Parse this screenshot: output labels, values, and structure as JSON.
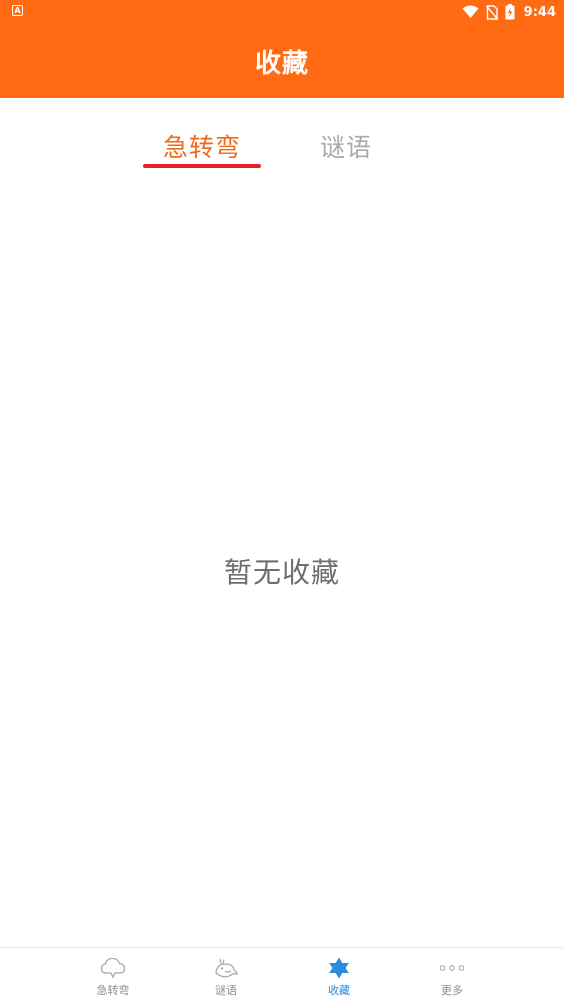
{
  "status_bar": {
    "left_icon": "a-notification-icon",
    "time": "9:44",
    "icons": [
      "wifi-icon",
      "no-sim-icon",
      "battery-charging-icon"
    ]
  },
  "header": {
    "title": "收藏"
  },
  "tabs": [
    {
      "label": "急转弯",
      "active": true
    },
    {
      "label": "谜语",
      "active": false
    }
  ],
  "content": {
    "empty_message": "暂无收藏"
  },
  "bottom_nav": {
    "items": [
      {
        "label": "急转弯",
        "icon": "cloud-icon",
        "active": false
      },
      {
        "label": "谜语",
        "icon": "bird-icon",
        "active": false
      },
      {
        "label": "收藏",
        "icon": "star-icon",
        "active": true
      },
      {
        "label": "更多",
        "icon": "more-dots-icon",
        "active": false
      }
    ]
  },
  "colors": {
    "primary": "#FF6A13",
    "tab_active": "#EE6A19",
    "tab_underline": "#E8202A",
    "tab_inactive": "#A9A9A9",
    "nav_active": "#2A8BDD",
    "nav_inactive": "#8C8C8C"
  }
}
